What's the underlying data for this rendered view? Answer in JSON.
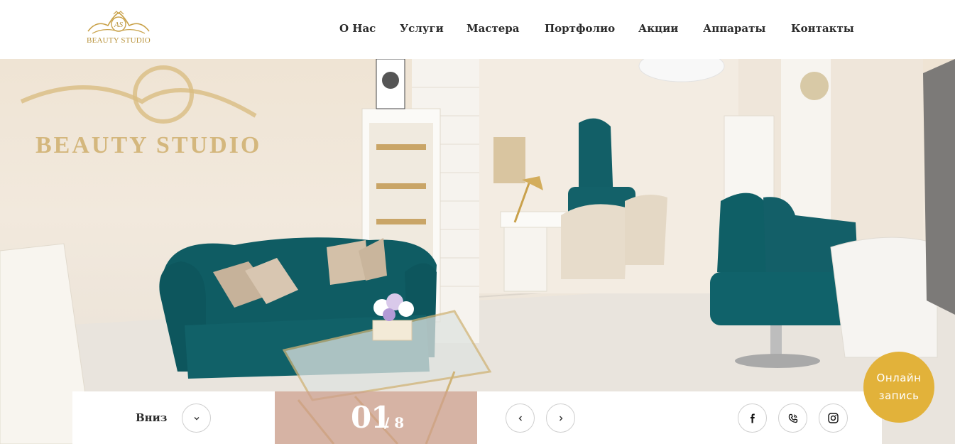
{
  "header": {
    "logo": {
      "monogram": "AS",
      "text": "BEAUTY STUDIO"
    },
    "nav": [
      {
        "label": "О Нас"
      },
      {
        "label": "Услуги"
      },
      {
        "label": "Мастера"
      },
      {
        "label": "Портфолио"
      },
      {
        "label": "Акции"
      },
      {
        "label": "Аппараты"
      },
      {
        "label": "Контакты"
      }
    ]
  },
  "hero": {
    "wall_sign": "BEAUTY STUDIO"
  },
  "slider": {
    "down_label": "Вниз",
    "current": "01",
    "total": "/ 8",
    "prev_icon": "chevron-left-icon",
    "next_icon": "chevron-right-icon"
  },
  "social": [
    {
      "icon": "facebook-icon"
    },
    {
      "icon": "viber-icon"
    },
    {
      "icon": "instagram-icon"
    }
  ],
  "cta": {
    "line1": "Онлайн",
    "line2": "запись"
  },
  "colors": {
    "gold": "#e2b23a",
    "text": "#2b2b2b",
    "counter_bg": "#cea08e",
    "teal": "#0e5f66"
  }
}
